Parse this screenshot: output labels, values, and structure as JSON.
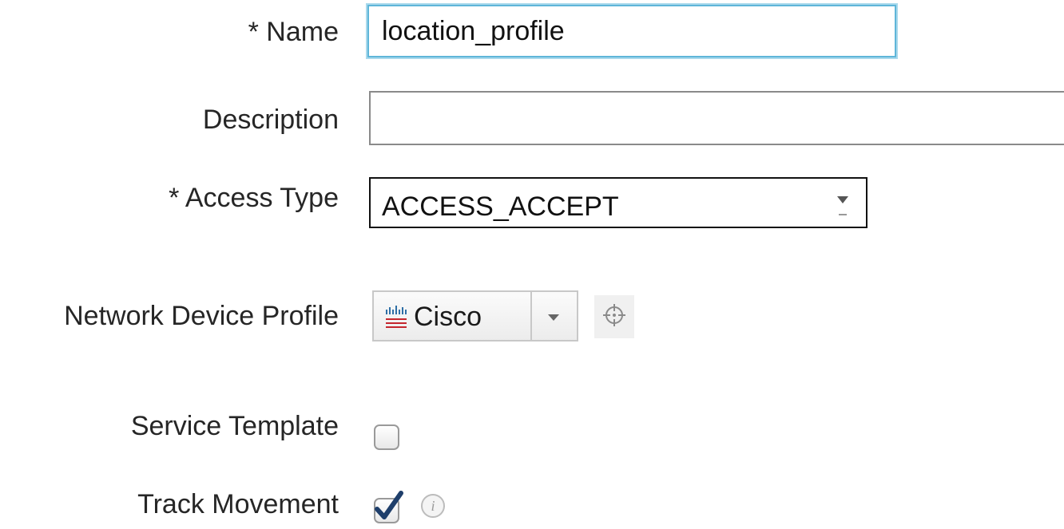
{
  "form": {
    "name": {
      "label": "* Name",
      "value": "location_profile"
    },
    "description": {
      "label": "Description",
      "value": ""
    },
    "access_type": {
      "label": "* Access Type",
      "selected": "ACCESS_ACCEPT"
    },
    "network_device_profile": {
      "label": "Network Device Profile",
      "selected": "Cisco",
      "logo_text": "cisco"
    },
    "service_template": {
      "label": "Service Template",
      "checked": false
    },
    "track_movement": {
      "label": "Track Movement",
      "checked": true
    }
  },
  "icons": {
    "dropdown": "chevron-down-icon",
    "select_target": "crosshair-target-icon",
    "info": "info-icon",
    "checkmark": "checkmark-icon",
    "logo": "cisco-logo-icon"
  },
  "colors": {
    "focus_border": "#5fb6d9",
    "checkmark": "#1f3f6b",
    "logo_blue": "#2f6fa6",
    "logo_red": "#c4262e"
  }
}
